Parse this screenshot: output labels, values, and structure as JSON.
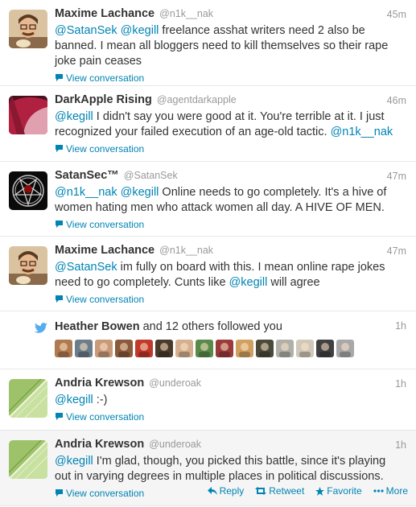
{
  "tweets": [
    {
      "fullname": "Maxime Lachance",
      "username": "@n1k__nak",
      "time": "45m",
      "segments": [
        {
          "text": "@SatanSek",
          "mention": true
        },
        {
          "text": " ",
          "mention": false
        },
        {
          "text": "@kegill",
          "mention": true
        },
        {
          "text": " freelance asshat writers need 2 also be banned. I mean all bloggers need to kill themselves so their rape joke pain ceases",
          "mention": false
        }
      ],
      "view_conversation": "View conversation",
      "avatar_icon": "man-with-glasses-avatar"
    },
    {
      "fullname": "DarkApple Rising",
      "username": "@agentdarkapple",
      "time": "46m",
      "segments": [
        {
          "text": "@kegill",
          "mention": true
        },
        {
          "text": " I didn't say you were good at it. You're terrible at it. I just recognized your failed execution of an age-old tactic. ",
          "mention": false
        },
        {
          "text": "@n1k__nak",
          "mention": true
        }
      ],
      "view_conversation": "View conversation",
      "avatar_icon": "red-haired-woman-avatar"
    },
    {
      "fullname": "SatanSec™",
      "username": "@SatanSek",
      "time": "47m",
      "segments": [
        {
          "text": "@n1k__nak",
          "mention": true
        },
        {
          "text": " ",
          "mention": false
        },
        {
          "text": "@kegill",
          "mention": true
        },
        {
          "text": " Online needs to go completely. It's a hive of women hating men who attack women all day. A HIVE OF MEN.",
          "mention": false
        }
      ],
      "view_conversation": "View conversation",
      "avatar_icon": "pentagram-avatar"
    },
    {
      "fullname": "Maxime Lachance",
      "username": "@n1k__nak",
      "time": "47m",
      "segments": [
        {
          "text": "@SatanSek",
          "mention": true
        },
        {
          "text": " im fully on board with this. I mean online rape jokes need to go completely. Cunts like ",
          "mention": false
        },
        {
          "text": "@kegill",
          "mention": true
        },
        {
          "text": " will agree",
          "mention": false
        }
      ],
      "view_conversation": "View conversation",
      "avatar_icon": "man-with-glasses-avatar"
    }
  ],
  "follow": {
    "name": "Heather Bowen",
    "rest": " and 12 others followed you",
    "time": "1h",
    "thumb_colors": [
      "#b07a50",
      "#6b7c8a",
      "#c89a7a",
      "#8a5a3a",
      "#c0392b",
      "#4a3a2a",
      "#d4b090",
      "#5a8a4a",
      "#9a3a3a",
      "#d0a060",
      "#4a4a3a",
      "#b0b0a8",
      "#d0c8b8",
      "#404040",
      "#a8a8a8"
    ]
  },
  "tweets2": [
    {
      "fullname": "Andria Krewson",
      "username": "@underoak",
      "time": "1h",
      "segments": [
        {
          "text": "@kegill",
          "mention": true
        },
        {
          "text": " :-)",
          "mention": false
        }
      ],
      "view_conversation": "View conversation",
      "avatar_icon": "green-leaf-avatar"
    },
    {
      "fullname": "Andria Krewson",
      "username": "@underoak",
      "time": "1h",
      "segments": [
        {
          "text": "@kegill",
          "mention": true
        },
        {
          "text": " I'm glad, though, you picked this battle, since it's playing out in varying degrees in multiple places in political discussions.",
          "mention": false
        }
      ],
      "view_conversation": "View conversation",
      "avatar_icon": "green-leaf-avatar"
    }
  ],
  "actions": {
    "reply": "Reply",
    "retweet": "Retweet",
    "favorite": "Favorite",
    "more": "More"
  },
  "colors": {
    "link": "#0084b4",
    "text": "#333333",
    "muted": "#999999",
    "hover_bg": "#f5f5f5"
  }
}
